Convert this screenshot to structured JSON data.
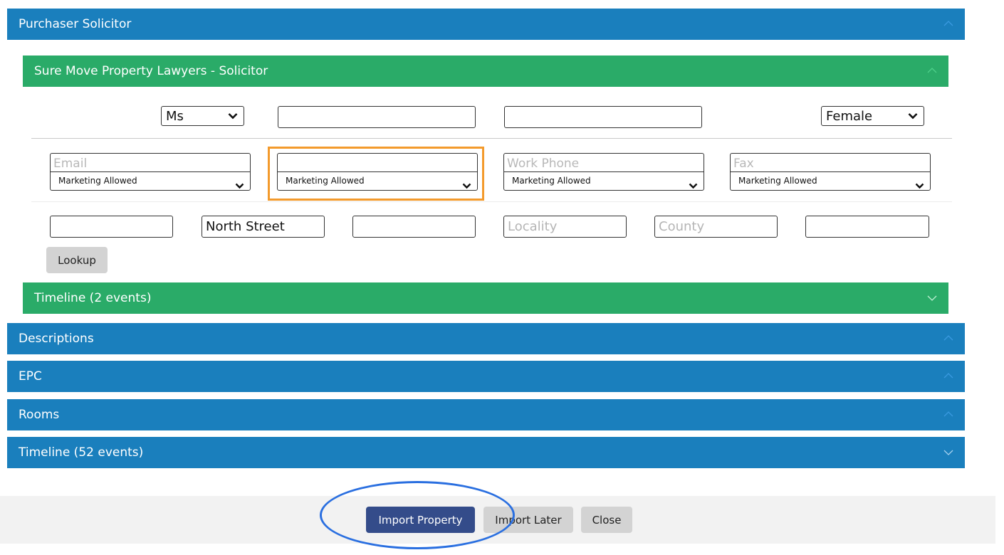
{
  "sections": {
    "purchaser_solicitor": "Purchaser Solicitor",
    "solicitor_panel": "Sure Move Property Lawyers - Solicitor",
    "solicitor_timeline": "Timeline (2 events)",
    "descriptions": "Descriptions",
    "epc": "EPC",
    "rooms": "Rooms",
    "timeline": "Timeline (52 events)"
  },
  "contact": {
    "title_value": "Ms",
    "first_name": "",
    "last_name": "",
    "gender_value": "Female"
  },
  "channels": [
    {
      "placeholder": "Email",
      "marketing": "Marketing Allowed"
    },
    {
      "placeholder": "",
      "marketing": "Marketing Allowed"
    },
    {
      "placeholder": "Work Phone",
      "marketing": "Marketing Allowed"
    },
    {
      "placeholder": "Fax",
      "marketing": "Marketing Allowed"
    }
  ],
  "address": {
    "house": "",
    "street": "North Street",
    "town": "",
    "locality_placeholder": "Locality",
    "county_placeholder": "County",
    "postcode": "",
    "lookup_label": "Lookup"
  },
  "footer": {
    "import_label": "Import Property",
    "import_later_label": "Import Later",
    "close_label": "Close"
  },
  "colors": {
    "section_blue": "#1a7fbd",
    "section_green": "#2aab68",
    "primary_button": "#344c8a",
    "highlight_orange": "#f39a2c",
    "highlight_blue": "#2a6fe0"
  }
}
